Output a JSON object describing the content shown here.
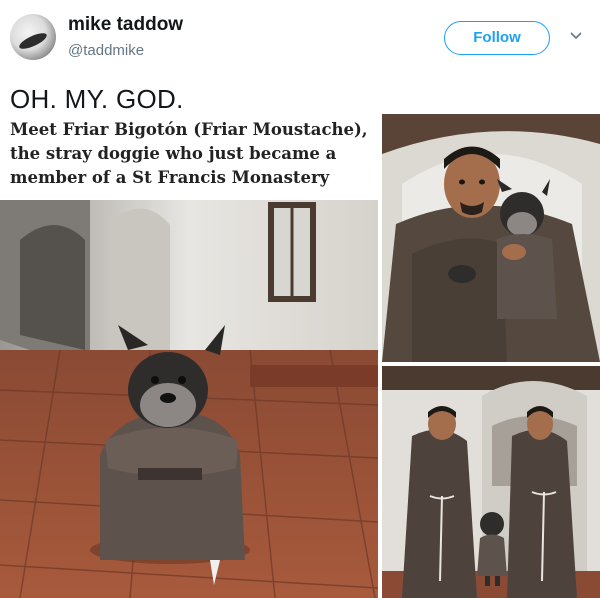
{
  "tweet": {
    "author_name": "mike taddow",
    "author_handle": "@taddmike",
    "follow_label": "Follow",
    "text": "OH. MY. GOD."
  },
  "media": {
    "caption": "Meet Friar Bigotón (Friar Moustache), the stray doggie who just became a member of a St Francis Monastery"
  },
  "icons": {
    "menu": "chevron-down-icon"
  },
  "colors": {
    "accent": "#1da1f2",
    "handle": "#657786",
    "robe": "#5a4e48"
  }
}
